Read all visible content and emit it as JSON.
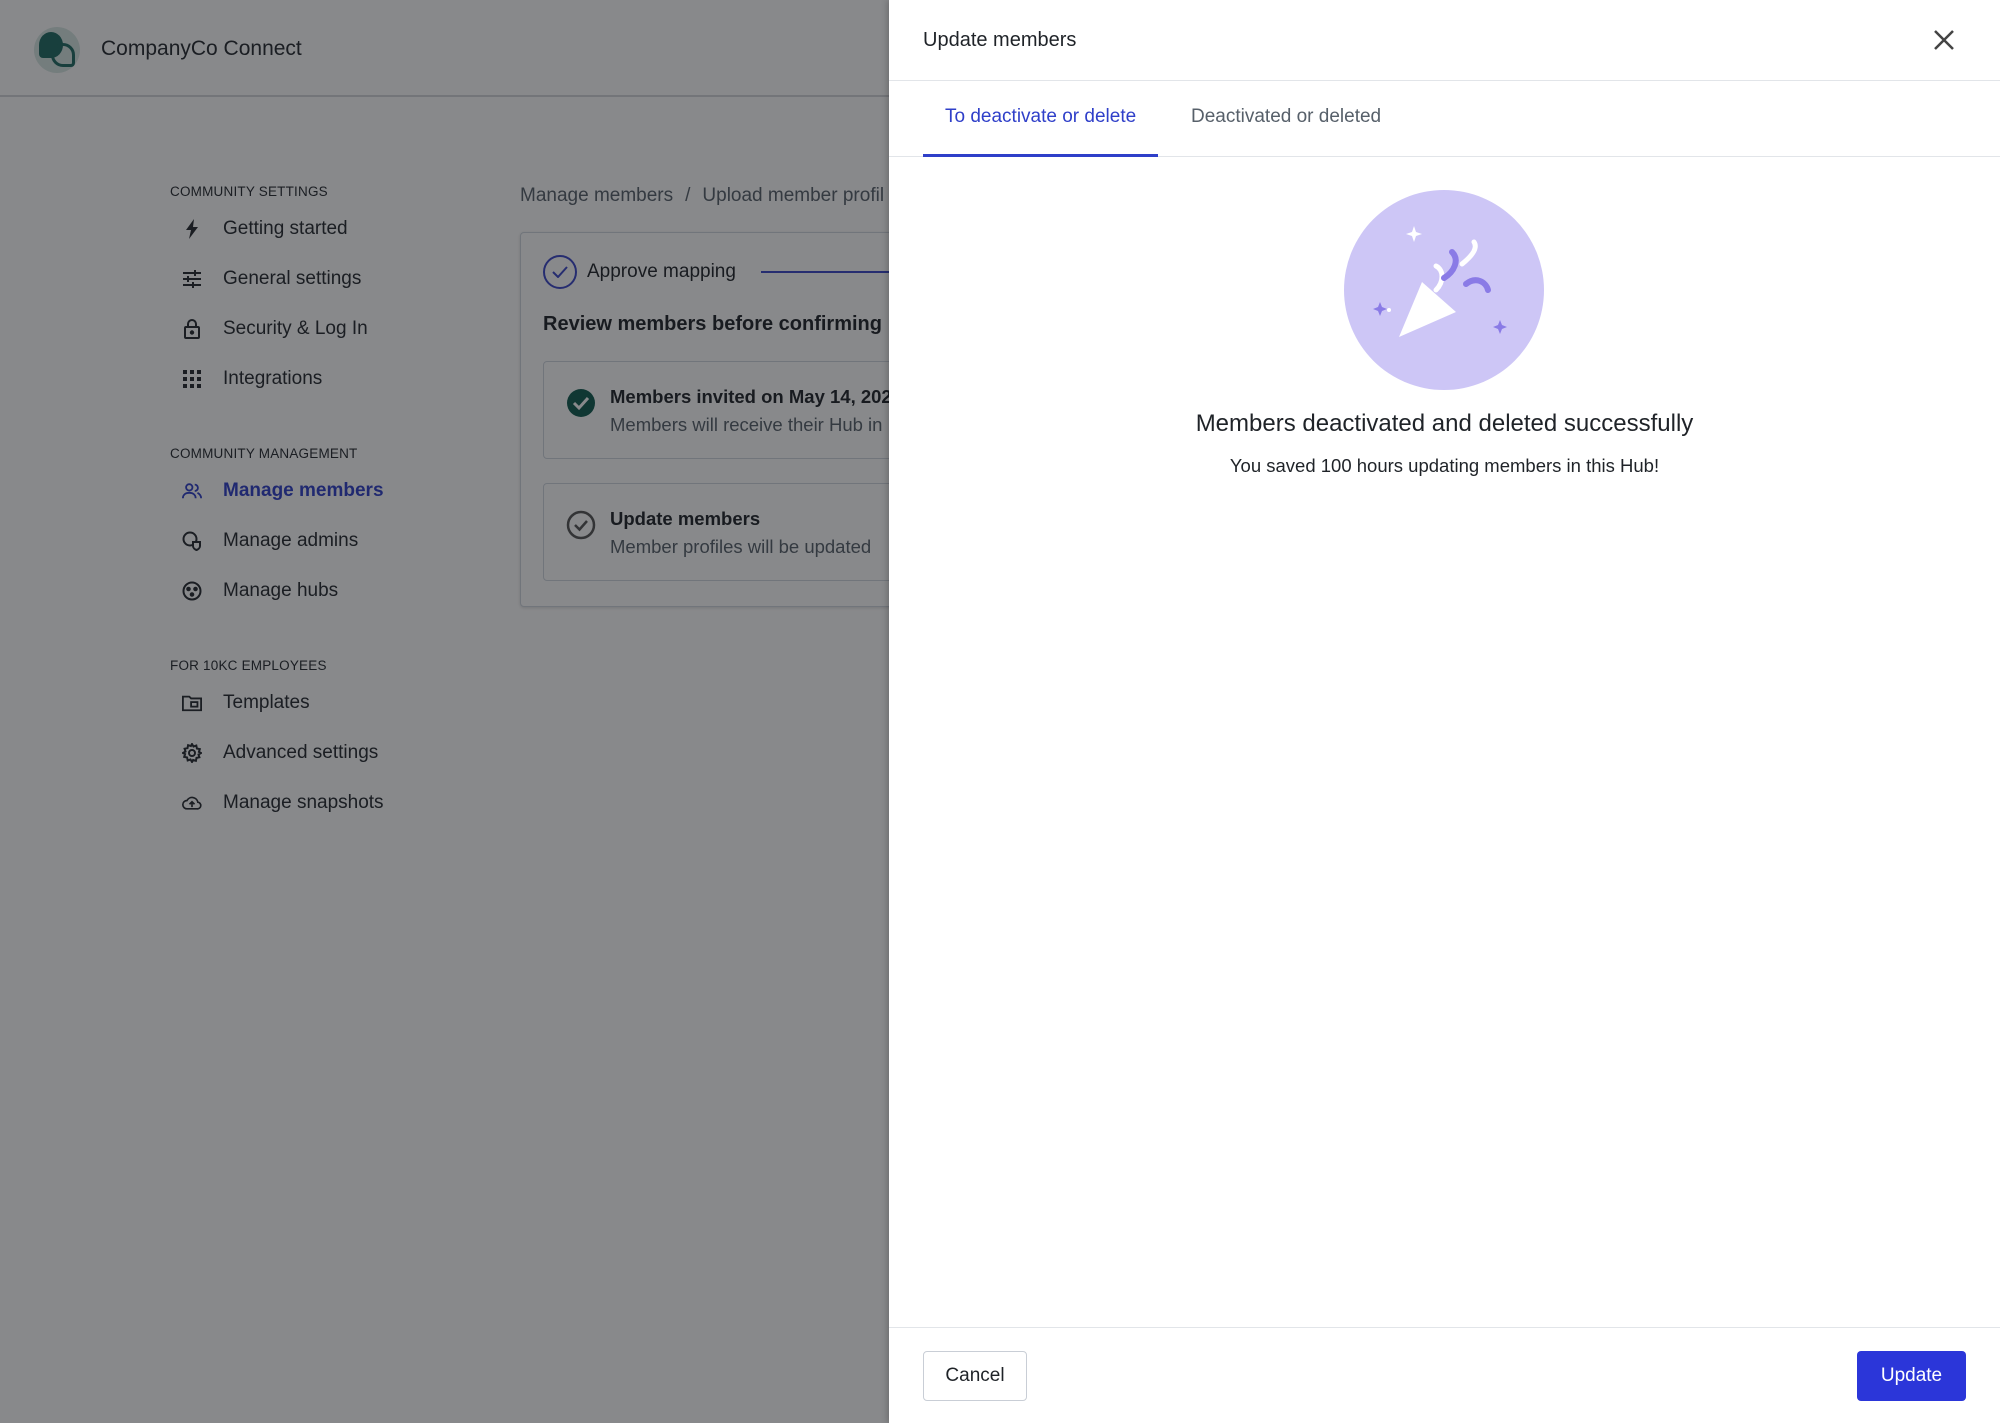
{
  "app": {
    "title": "CompanyCo Connect"
  },
  "sidebar": {
    "sections": [
      {
        "label": "COMMUNITY SETTINGS",
        "items": [
          {
            "label": "Getting started",
            "icon": "bolt-icon"
          },
          {
            "label": "General settings",
            "icon": "sliders-icon"
          },
          {
            "label": "Security & Log In",
            "icon": "lock-icon"
          },
          {
            "label": "Integrations",
            "icon": "grid-icon"
          }
        ]
      },
      {
        "label": "COMMUNITY MANAGEMENT",
        "items": [
          {
            "label": "Manage members",
            "icon": "users-icon",
            "active": true
          },
          {
            "label": "Manage admins",
            "icon": "admin-shield-icon"
          },
          {
            "label": "Manage hubs",
            "icon": "hubs-icon"
          }
        ]
      },
      {
        "label": "FOR 10KC EMPLOYEES",
        "items": [
          {
            "label": "Templates",
            "icon": "folder-icon"
          },
          {
            "label": "Advanced settings",
            "icon": "gear-icon"
          },
          {
            "label": "Manage snapshots",
            "icon": "cloud-upload-icon"
          }
        ]
      }
    ]
  },
  "breadcrumb": {
    "items": [
      "Manage members",
      "Upload member profil"
    ],
    "separator": "/"
  },
  "main": {
    "step_label": "Approve mapping",
    "review_title": "Review members before confirming",
    "items": [
      {
        "title": "Members invited on May 14, 202",
        "subtitle": "Members will receive their Hub in"
      },
      {
        "title": "Update members",
        "subtitle": "Member profiles will be updated"
      }
    ]
  },
  "drawer": {
    "title": "Update members",
    "tabs": [
      {
        "label": "To deactivate or delete",
        "active": true
      },
      {
        "label": "Deactivated or deleted",
        "active": false
      }
    ],
    "success_title": "Members deactivated and deleted successfully",
    "success_subtitle": "You saved 100 hours updating members in this Hub!",
    "cancel_label": "Cancel",
    "update_label": "Update"
  },
  "colors": {
    "accent": "#2f3fc9",
    "primary_button": "#2b36d9",
    "brand_teal": "#1e6b62",
    "hero_circle": "#cdc6f6",
    "hero_stroke": "#8a7be6"
  }
}
